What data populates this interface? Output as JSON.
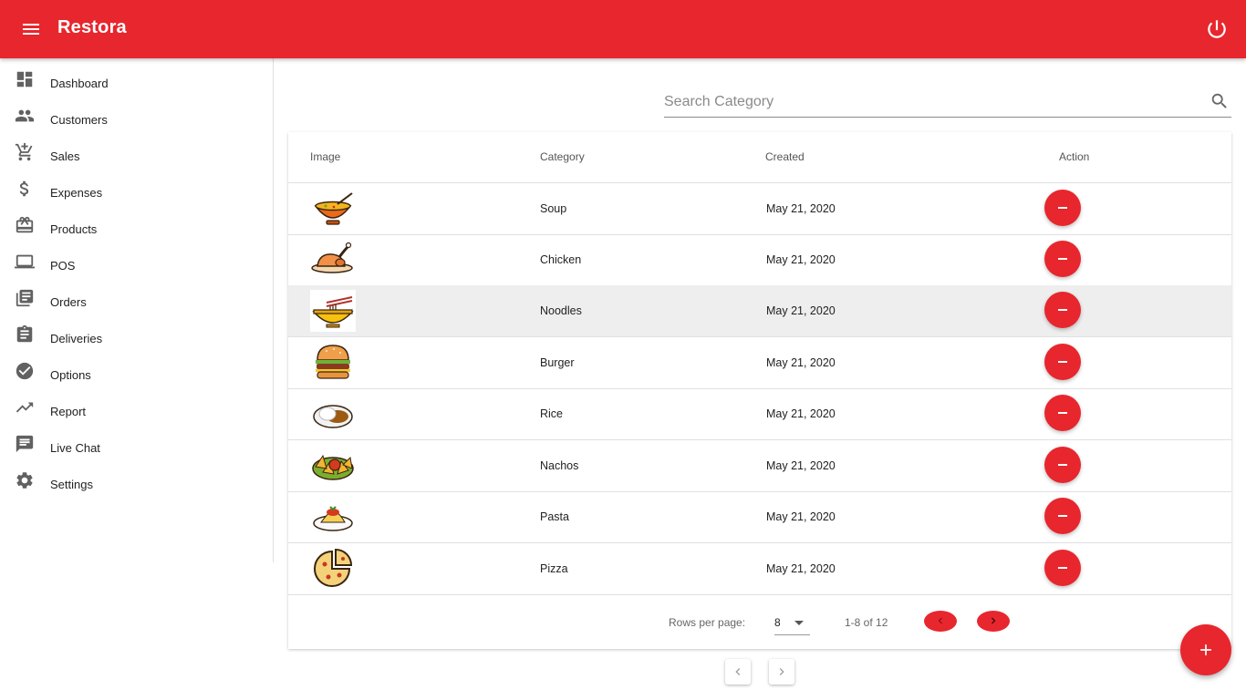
{
  "app": {
    "title": "Restora"
  },
  "sidebar": {
    "items": [
      {
        "label": "Dashboard",
        "icon": "dashboard-icon"
      },
      {
        "label": "Customers",
        "icon": "people-icon"
      },
      {
        "label": "Sales",
        "icon": "add-shopping-cart-icon"
      },
      {
        "label": "Expenses",
        "icon": "dollar-icon"
      },
      {
        "label": "Products",
        "icon": "card-giftcard-icon"
      },
      {
        "label": "POS",
        "icon": "laptop-icon"
      },
      {
        "label": "Orders",
        "icon": "library-books-icon"
      },
      {
        "label": "Deliveries",
        "icon": "assignment-icon"
      },
      {
        "label": "Options",
        "icon": "check-circle-icon"
      },
      {
        "label": "Report",
        "icon": "trending-up-icon"
      },
      {
        "label": "Live Chat",
        "icon": "chat-icon"
      },
      {
        "label": "Settings",
        "icon": "settings-gear-icon"
      }
    ]
  },
  "search": {
    "placeholder": "Search Category",
    "value": ""
  },
  "table": {
    "headers": {
      "image": "Image",
      "category": "Category",
      "created": "Created",
      "action": "Action"
    },
    "rows": [
      {
        "category": "Soup",
        "created": "May 21, 2020",
        "image": "soup-bowl-icon"
      },
      {
        "category": "Chicken",
        "created": "May 21, 2020",
        "image": "roast-chicken-icon"
      },
      {
        "category": "Noodles",
        "created": "May 21, 2020",
        "image": "noodle-bowl-icon"
      },
      {
        "category": "Burger",
        "created": "May 21, 2020",
        "image": "burger-icon"
      },
      {
        "category": "Rice",
        "created": "May 21, 2020",
        "image": "curry-rice-icon"
      },
      {
        "category": "Nachos",
        "created": "May 21, 2020",
        "image": "nachos-icon"
      },
      {
        "category": "Pasta",
        "created": "May 21, 2020",
        "image": "pasta-icon"
      },
      {
        "category": "Pizza",
        "created": "May 21, 2020",
        "image": "pizza-icon"
      }
    ],
    "highlighted_row": 2
  },
  "pagination": {
    "rows_per_page_label": "Rows per page:",
    "rows_per_page": "8",
    "range": "1-8 of 12"
  },
  "colors": {
    "primary": "#e8262d",
    "text": "#212121",
    "muted": "#666666",
    "divider": "#e0e0e0"
  }
}
